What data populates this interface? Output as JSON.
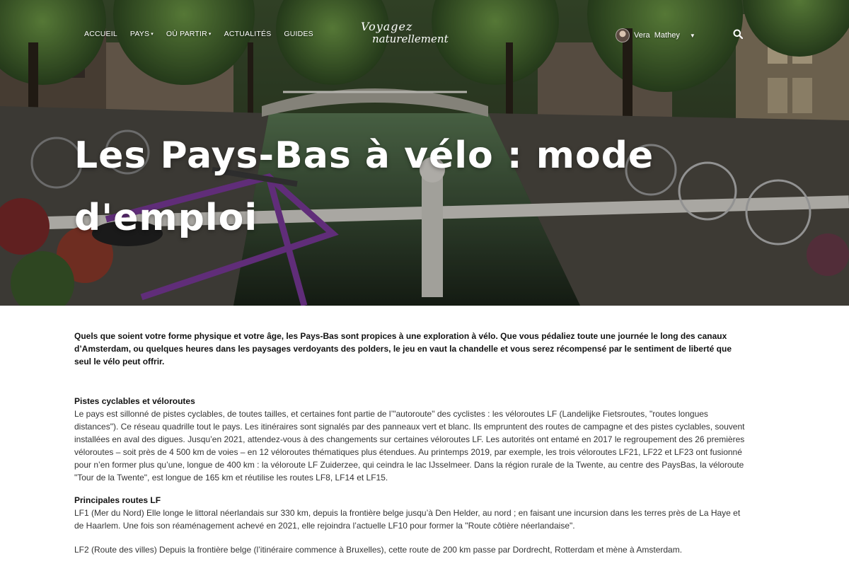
{
  "nav": {
    "items": [
      {
        "label": "ACCUEIL",
        "has_caret": false
      },
      {
        "label": "PAYS",
        "has_caret": true
      },
      {
        "label": "OÙ PARTIR",
        "has_caret": true
      },
      {
        "label": "ACTUALITÉS",
        "has_caret": false
      },
      {
        "label": "GUIDES",
        "has_caret": false
      }
    ],
    "logo_line1": "Voyagez",
    "logo_line2": "naturellement",
    "user_name": "Vera  Mathey",
    "icons": {
      "search": "search-icon",
      "user_menu": "chevron-down-icon",
      "avatar": "avatar"
    }
  },
  "hero": {
    "title": "Les Pays-Bas à vélo : mode d'emploi"
  },
  "article": {
    "lead": "Quels que soient votre forme physique et votre âge, les Pays-Bas sont propices à une exploration à vélo. Que vous pédaliez toute une journée le long des canaux d’Amsterdam, ou quelques heures dans les paysages verdoyants des polders, le jeu en vaut la chandelle et vous serez récompensé par le sentiment de liberté que seul le vélo peut offrir.",
    "section1_title": "Pistes cyclables et véloroutes",
    "section1_text": "Le pays est sillonné de pistes cyclables, de toutes tailles, et certaines font partie de l’\"autoroute\" des cyclistes : les véloroutes LF (Landelijke Fietsroutes, \"routes longues distances\"). Ce réseau quadrille tout le pays. Les itinéraires sont signalés par des panneaux vert et blanc. Ils empruntent des routes de campagne et des pistes cyclables, souvent installées en aval des digues. Jusqu’en 2021, attendez-vous à des changements sur certaines véloroutes LF. Les autorités ont entamé en 2017 le regroupement des 26 premières véloroutes – soit près de 4 500 km de voies – en 12 véloroutes thématiques plus étendues. Au printemps 2019, par exemple, les trois véloroutes LF21, LF22 et LF23 ont fusionné pour n’en former plus qu’une, longue de 400 km : la véloroute LF Zuiderzee, qui ceindra le lac IJsselmeer. Dans la région rurale de la Twente, au centre des PaysBas, la véloroute \"Tour de la Twente\", est longue de 165 km et réutilise les routes LF8, LF14 et LF15.",
    "section2_title": "Principales routes LF",
    "section2_p1": "LF1 (Mer du Nord) Elle longe le littoral néerlandais sur 330 km, depuis la frontière belge jusqu’à Den Helder, au nord ; en faisant une incursion dans les terres près de La Haye et de Haarlem. Une fois son réaménagement achevé en 2021, elle rejoindra l’actuelle LF10 pour former la \"Route côtière néerlandaise\".",
    "section2_p2": "LF2 (Route des villes) Depuis la frontière belge (l’itinéraire commence à Bruxelles), cette route de 200 km passe par Dordrecht, Rotterdam et mène à Amsterdam."
  }
}
